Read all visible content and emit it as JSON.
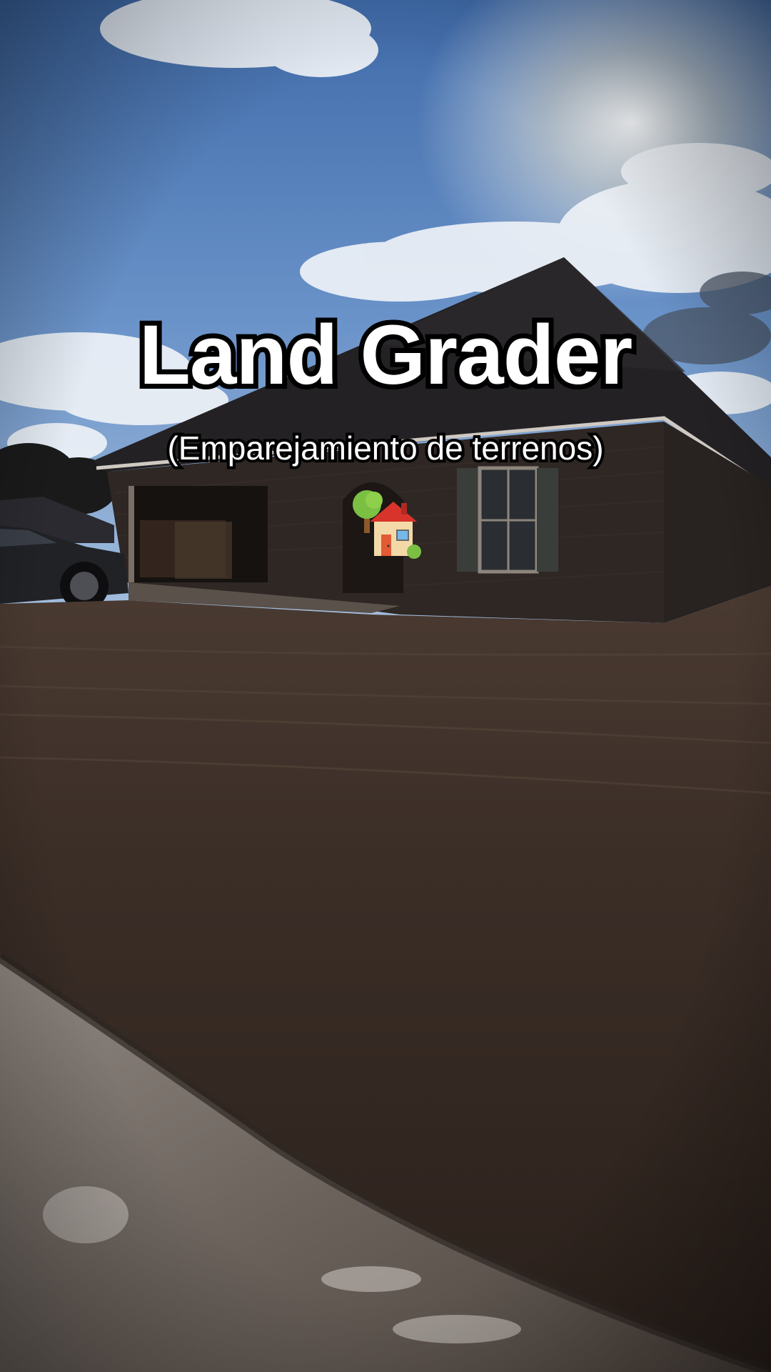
{
  "overlay": {
    "title": "Land Grader",
    "subtitle": "(Emparejamiento de terrenos)",
    "emoji_icon": "house-with-garden-icon"
  },
  "colors": {
    "sky": "#4a78b8",
    "dirt": "#3a2c24",
    "brick": "#2c2522",
    "roof": "#1f1d1e",
    "text_fill": "#ffffff",
    "text_stroke": "#000000"
  }
}
